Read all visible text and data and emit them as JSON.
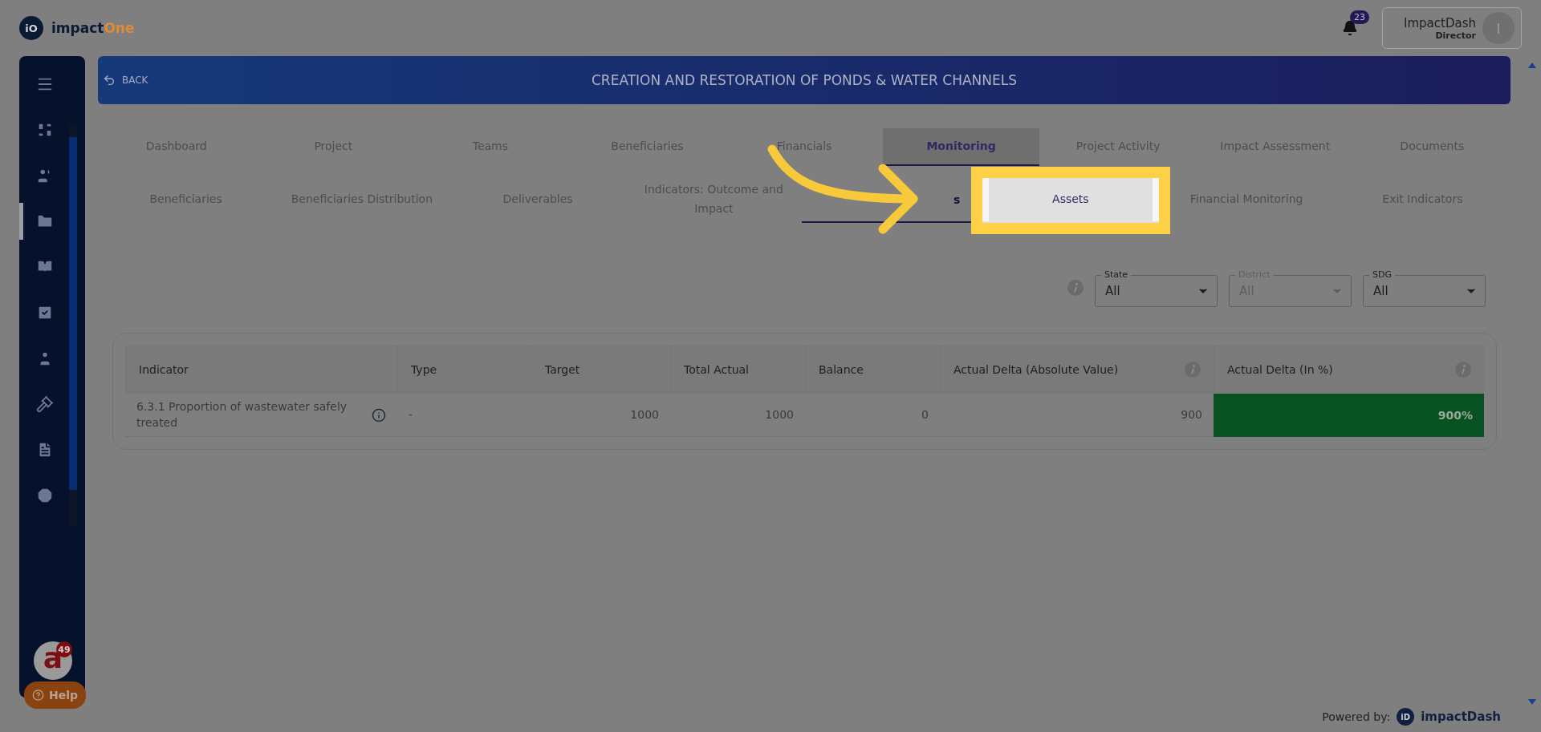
{
  "topbar": {
    "logo": {
      "mark": "iO",
      "name": "impact",
      "accent": "One"
    },
    "notifications": {
      "badge": "23"
    },
    "user": {
      "name": "ImpactDash",
      "role": "Director",
      "initial": "I"
    }
  },
  "sidebar": {
    "items": [
      {
        "selected": false
      },
      {
        "selected": false
      },
      {
        "selected": false
      },
      {
        "selected": true
      },
      {
        "selected": false
      },
      {
        "selected": false
      },
      {
        "selected": false
      },
      {
        "selected": false
      },
      {
        "selected": false
      },
      {
        "selected": false
      }
    ]
  },
  "banner": {
    "back": "BACK",
    "title": "CREATION AND RESTORATION OF PONDS & WATER CHANNELS"
  },
  "tabs": [
    {
      "label": "Dashboard",
      "selected": false
    },
    {
      "label": "Project",
      "selected": false
    },
    {
      "label": "Teams",
      "selected": false
    },
    {
      "label": "Beneficiaries",
      "selected": false
    },
    {
      "label": "Financials",
      "selected": false
    },
    {
      "label": "Monitoring",
      "selected": true
    },
    {
      "label": "Project Activity",
      "selected": false
    },
    {
      "label": "Impact Assessment",
      "selected": false
    },
    {
      "label": "Documents",
      "selected": false
    }
  ],
  "subtabs": [
    {
      "label": "Beneficiaries",
      "selected": false,
      "highlighted": false
    },
    {
      "label": "Beneficiaries Distribution",
      "selected": false,
      "highlighted": false
    },
    {
      "label": "Deliverables",
      "selected": false,
      "highlighted": false
    },
    {
      "label": "Indicators: Outcome and Impact",
      "selected": false,
      "highlighted": false
    },
    {
      "label": "s",
      "selected": true,
      "highlighted": false
    },
    {
      "label": "Assets",
      "selected": false,
      "highlighted": true
    },
    {
      "label": "Financial Monitoring",
      "selected": false,
      "highlighted": false
    },
    {
      "label": "Exit Indicators",
      "selected": false,
      "highlighted": false
    }
  ],
  "filters": [
    {
      "label": "State",
      "value": "All",
      "disabled": false
    },
    {
      "label": "District",
      "value": "All",
      "disabled": true
    },
    {
      "label": "SDG",
      "value": "All",
      "disabled": false
    }
  ],
  "table": {
    "columns": [
      {
        "label": "Indicator",
        "info": false
      },
      {
        "label": "Type",
        "info": false
      },
      {
        "label": "Target",
        "info": false
      },
      {
        "label": "Total Actual",
        "info": false
      },
      {
        "label": "Balance",
        "info": false
      },
      {
        "label": "Actual Delta (Absolute Value)",
        "info": true
      },
      {
        "label": "Actual Delta (In %)",
        "info": true
      }
    ],
    "rows": [
      {
        "indicator": "6.3.1 Proportion of wastewater safely treated",
        "info": true,
        "type": "-",
        "target": "1000",
        "total_actual": "1000",
        "balance": "0",
        "delta_absolute": "900",
        "delta_percent": "900%",
        "color": "#075220"
      }
    ]
  },
  "chat_widget": {
    "mark": "a",
    "badge": "49"
  },
  "help": {
    "label": "Help"
  },
  "footer": {
    "powered_by": "Powered by:",
    "logo": {
      "mark": "iD",
      "name": "impactDash"
    }
  }
}
